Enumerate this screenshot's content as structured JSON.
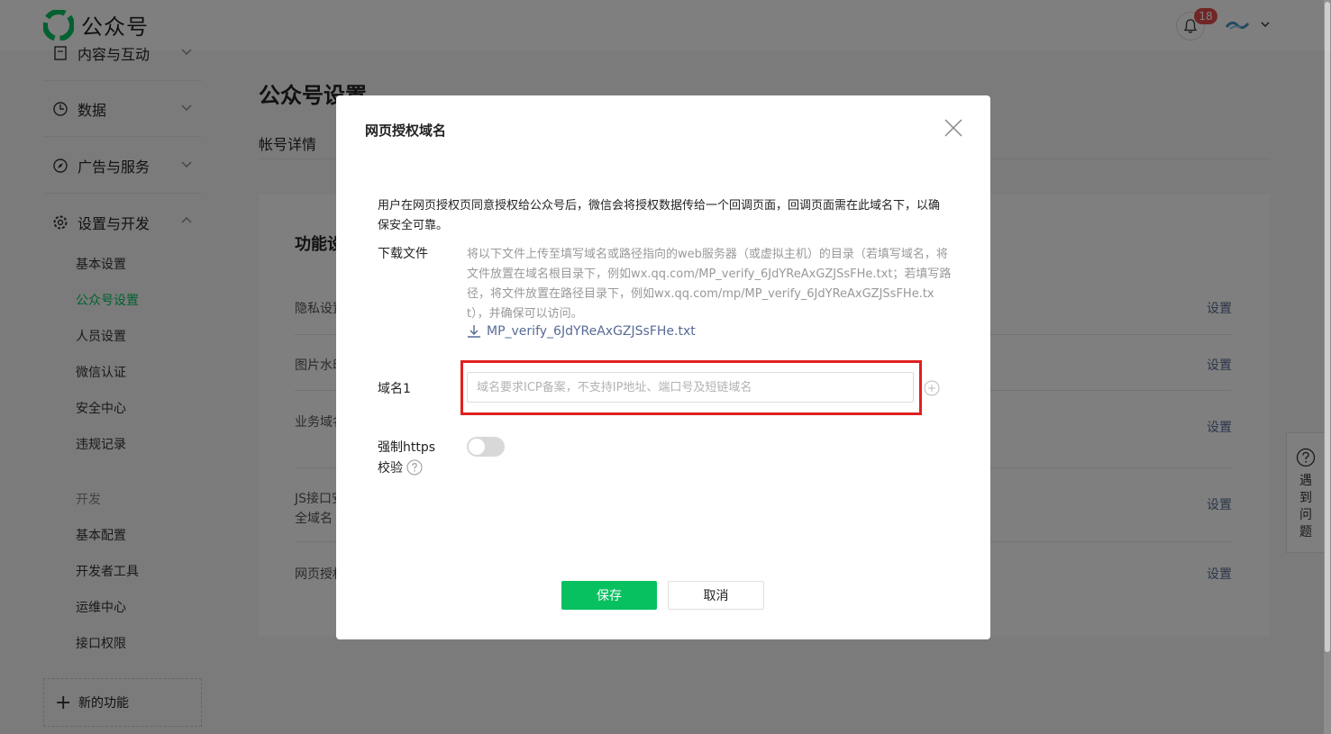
{
  "brand": {
    "name": "公众号",
    "color": "#07c160"
  },
  "header": {
    "notification_count": "18"
  },
  "sidebar": {
    "groups": [
      {
        "label": "内容与互动",
        "icon": "document-icon"
      },
      {
        "label": "数据",
        "icon": "chart-icon"
      },
      {
        "label": "广告与服务",
        "icon": "compass-icon"
      },
      {
        "label": "设置与开发",
        "icon": "gear-icon"
      }
    ],
    "items": [
      "基本设置",
      "公众号设置",
      "人员设置",
      "微信认证",
      "安全中心",
      "违规记录"
    ],
    "dev_heading": "开发",
    "dev_items": [
      "基本配置",
      "开发者工具",
      "运维中心",
      "接口权限"
    ],
    "new_feature": "新的功能"
  },
  "main": {
    "title": "公众号设置",
    "tab": "帐号详情",
    "section_title": "功能设置",
    "rows": [
      {
        "label": "隐私设置",
        "action": "设置"
      },
      {
        "label": "图片水印",
        "action": "设置"
      },
      {
        "label": "业务域名",
        "action": "设置"
      },
      {
        "label": "JS接口安全域名",
        "action": "设置"
      },
      {
        "label": "网页授权域名",
        "action": "设置"
      }
    ]
  },
  "help": {
    "label": "遇到问题"
  },
  "modal": {
    "title": "网页授权域名",
    "description": "用户在网页授权页同意授权给公众号后，微信会将授权数据传给一个回调页面，回调页面需在此域名下，以确保安全可靠。",
    "download_label": "下载文件",
    "download_desc": "将以下文件上传至填写域名或路径指向的web服务器（或虚拟主机）的目录（若填写域名，将文件放置在域名根目录下，例如wx.qq.com/MP_verify_6JdYReAxGZJSsFHe.txt；若填写路径，将文件放置在路径目录下，例如wx.qq.com/mp/MP_verify_6JdYReAxGZJSsFHe.txt），并确保可以访问。",
    "file_name": "MP_verify_6JdYReAxGZJSsFHe.txt",
    "domain_label": "域名1",
    "domain_placeholder": "域名要求ICP备案，不支持IP地址、端口号及短链域名",
    "domain_value": "",
    "https_label_1": "强制https",
    "https_label_2": "校验",
    "https_enabled": false,
    "save_label": "保存",
    "cancel_label": "取消"
  },
  "colors": {
    "highlight": "#e02020",
    "link": "#576b95",
    "badge": "#e34d4d"
  }
}
